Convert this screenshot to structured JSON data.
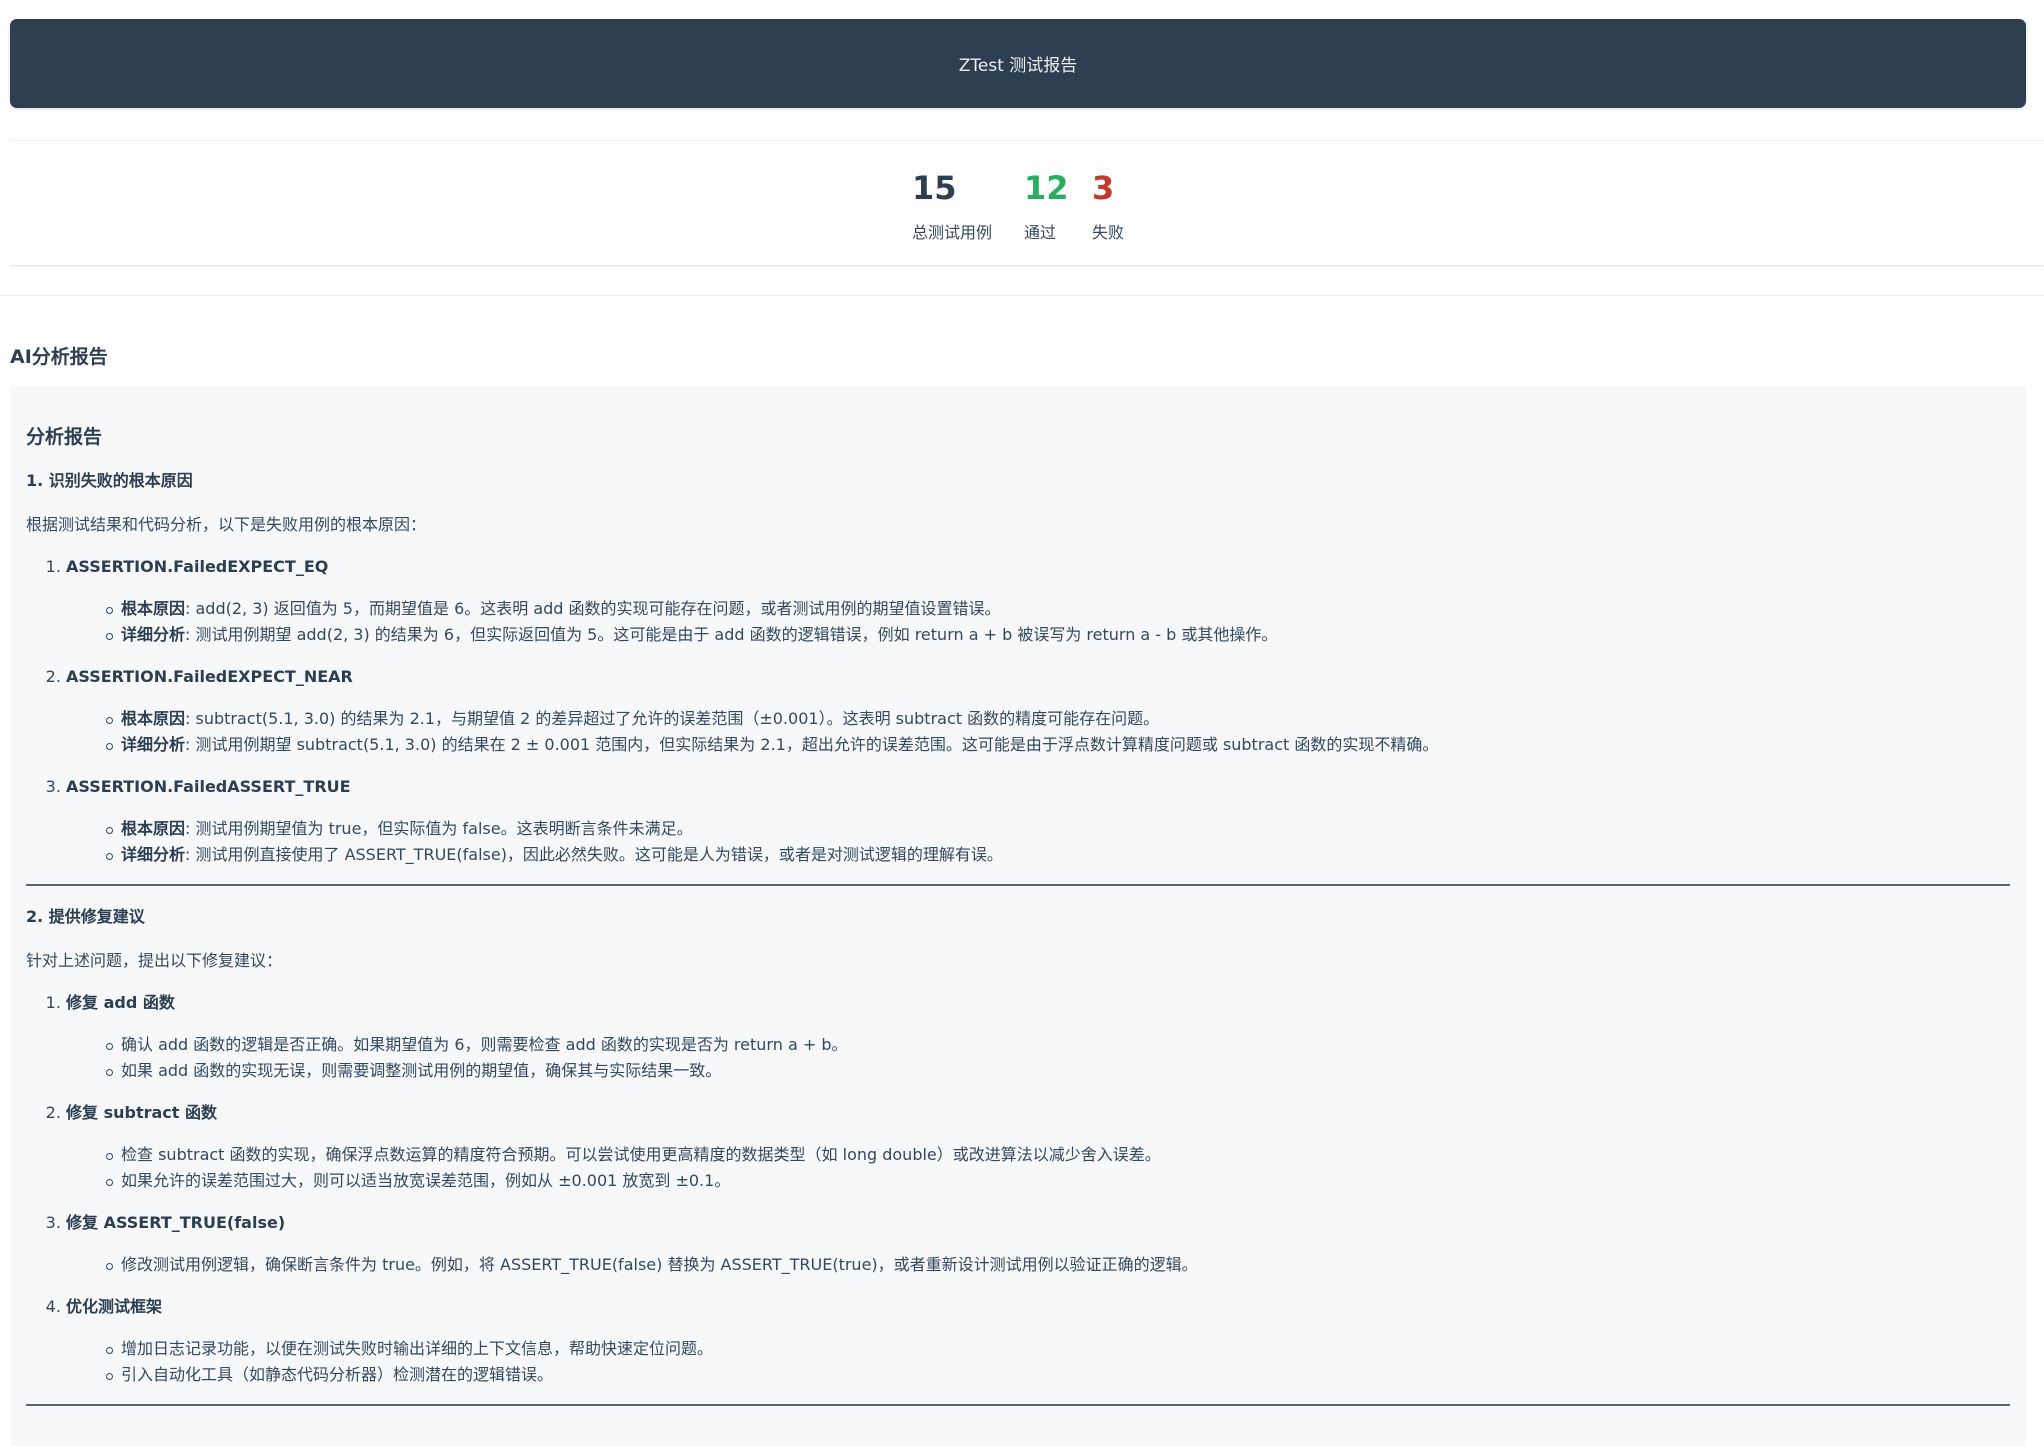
{
  "header": {
    "title": "ZTest 测试报告"
  },
  "summary": {
    "total": {
      "value": "15",
      "label": "总测试用例"
    },
    "passed": {
      "value": "12",
      "label": "通过"
    },
    "failed": {
      "value": "3",
      "label": "失败"
    }
  },
  "colors": {
    "header_bg": "#2c3e50",
    "pass": "#27ae60",
    "fail": "#c0392b"
  },
  "ai_section": {
    "title": "AI分析报告"
  },
  "report": {
    "title": "分析报告",
    "section1": {
      "heading": "1. 识别失败的根本原因",
      "intro": "根据测试结果和代码分析，以下是失败用例的根本原因：",
      "items": [
        {
          "title": "ASSERTION.FailedEXPECT_EQ",
          "root_label": "根本原因",
          "root_text": ": add(2, 3) 返回值为 5，而期望值是 6。这表明 add 函数的实现可能存在问题，或者测试用例的期望值设置错误。",
          "detail_label": "详细分析",
          "detail_text": ": 测试用例期望 add(2, 3) 的结果为 6，但实际返回值为 5。这可能是由于 add 函数的逻辑错误，例如 return a + b 被误写为 return a - b 或其他操作。"
        },
        {
          "title": "ASSERTION.FailedEXPECT_NEAR",
          "root_label": "根本原因",
          "root_text": ": subtract(5.1, 3.0) 的结果为 2.1，与期望值 2 的差异超过了允许的误差范围（±0.001）。这表明 subtract 函数的精度可能存在问题。",
          "detail_label": "详细分析",
          "detail_text": ": 测试用例期望 subtract(5.1, 3.0) 的结果在 2 ± 0.001 范围内，但实际结果为 2.1，超出允许的误差范围。这可能是由于浮点数计算精度问题或 subtract 函数的实现不精确。"
        },
        {
          "title": "ASSERTION.FailedASSERT_TRUE",
          "root_label": "根本原因",
          "root_text": ": 测试用例期望值为 true，但实际值为 false。这表明断言条件未满足。",
          "detail_label": "详细分析",
          "detail_text": ": 测试用例直接使用了 ASSERT_TRUE(false)，因此必然失败。这可能是人为错误，或者是对测试逻辑的理解有误。"
        }
      ]
    },
    "section2": {
      "heading": "2. 提供修复建议",
      "intro": "针对上述问题，提出以下修复建议：",
      "items": [
        {
          "title": "修复 add 函数",
          "bullets": [
            "确认 add 函数的逻辑是否正确。如果期望值为 6，则需要检查 add 函数的实现是否为 return a + b。",
            "如果 add 函数的实现无误，则需要调整测试用例的期望值，确保其与实际结果一致。"
          ]
        },
        {
          "title": "修复 subtract 函数",
          "bullets": [
            "检查 subtract 函数的实现，确保浮点数运算的精度符合预期。可以尝试使用更高精度的数据类型（如 long double）或改进算法以减少舍入误差。",
            "如果允许的误差范围过大，则可以适当放宽误差范围，例如从 ±0.001 放宽到 ±0.1。"
          ]
        },
        {
          "title": "修复 ASSERT_TRUE(false)",
          "bullets": [
            "修改测试用例逻辑，确保断言条件为 true。例如，将 ASSERT_TRUE(false) 替换为 ASSERT_TRUE(true)，或者重新设计测试用例以验证正确的逻辑。"
          ]
        },
        {
          "title": "优化测试框架",
          "bullets": [
            "增加日志记录功能，以便在测试失败时输出详细的上下文信息，帮助快速定位问题。",
            "引入自动化工具（如静态代码分析器）检测潜在的逻辑错误。"
          ]
        }
      ]
    }
  }
}
